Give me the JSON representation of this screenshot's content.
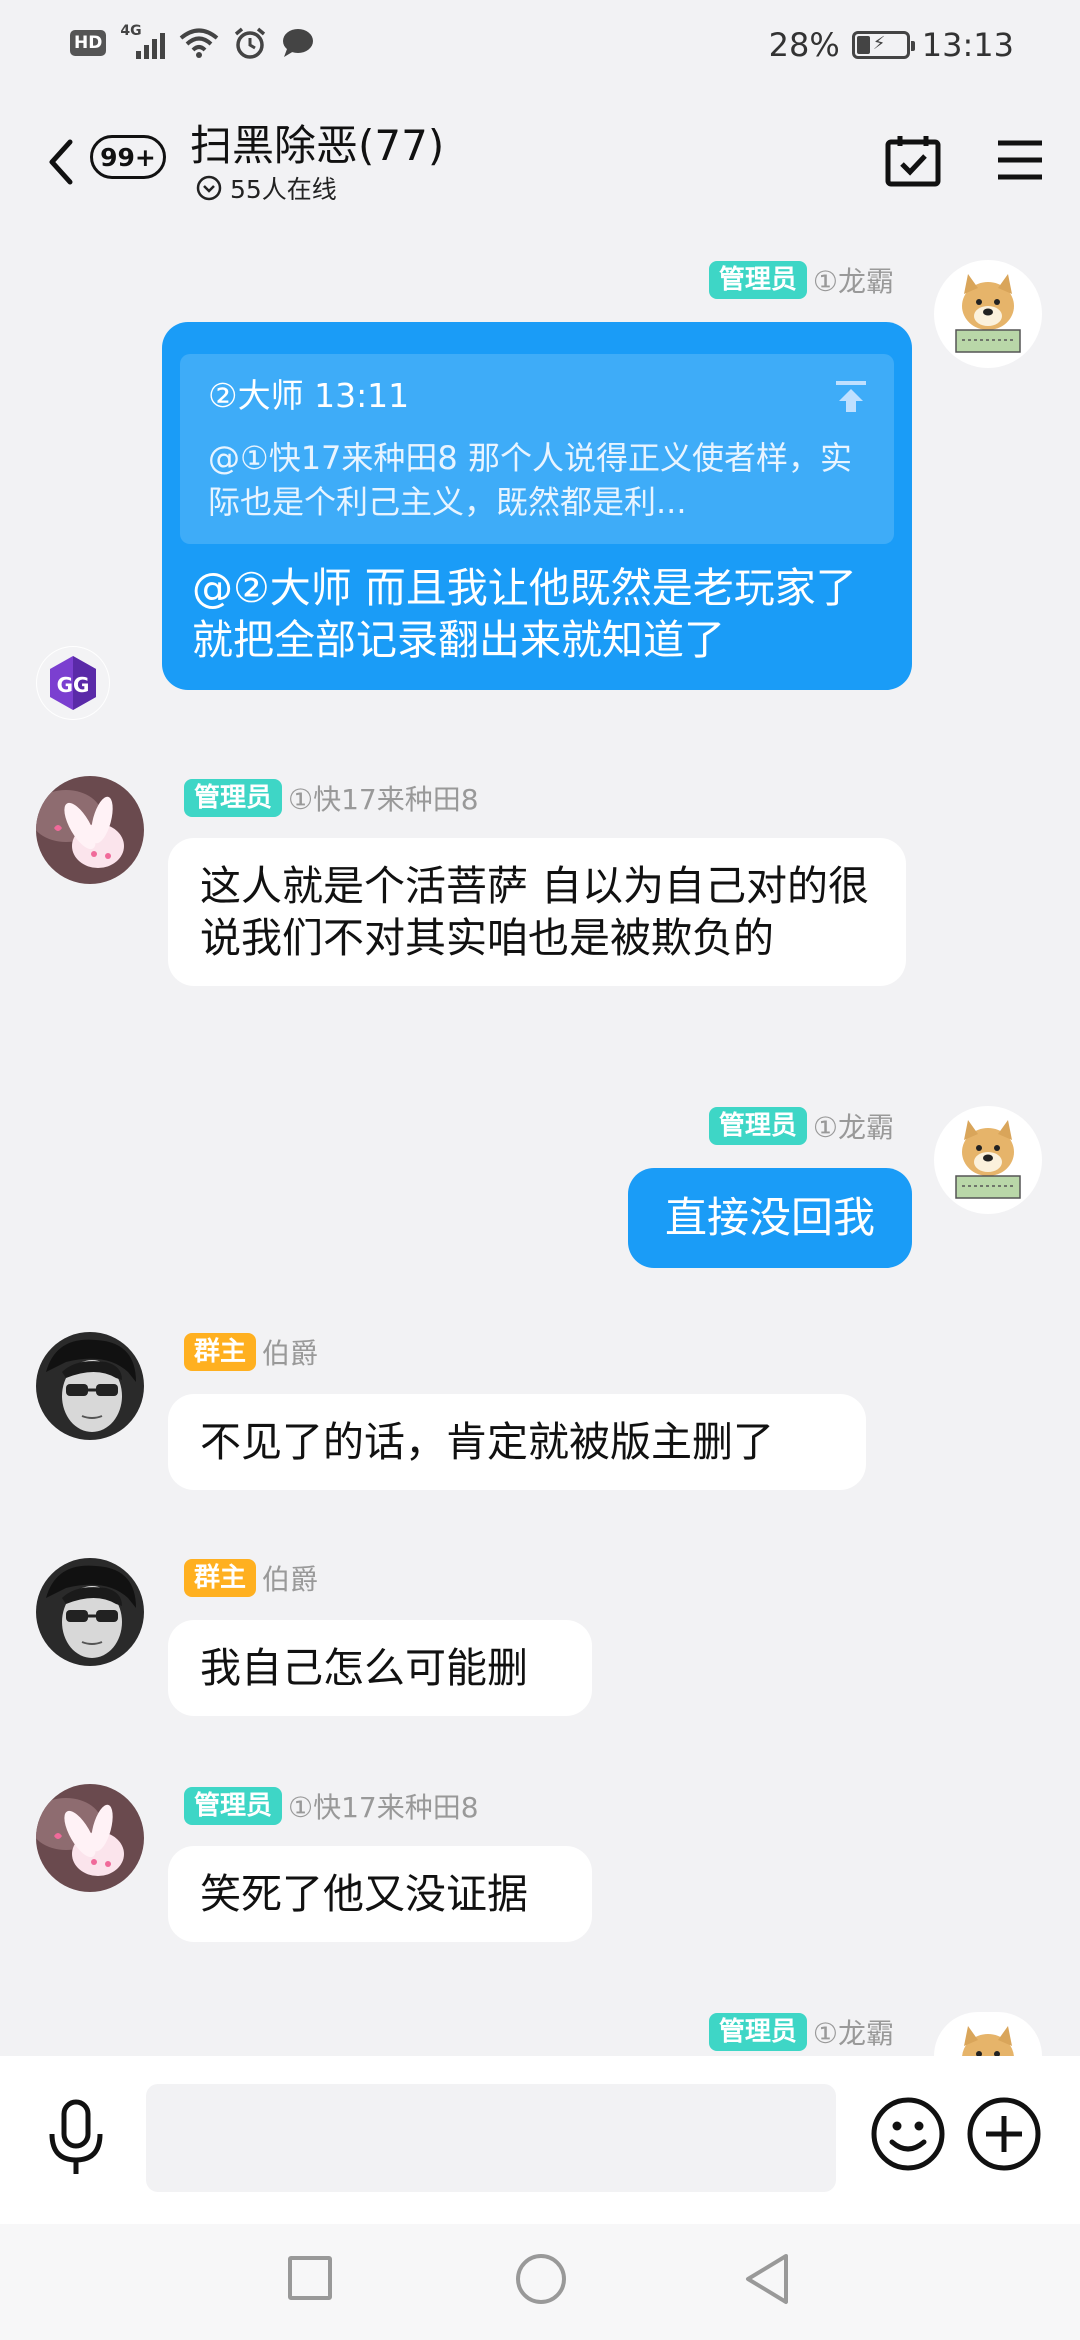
{
  "status_bar": {
    "hd": "HD",
    "network": "4G",
    "battery_percent": "28%",
    "battery_level": 0.28,
    "time": "13:13"
  },
  "header": {
    "unread_count": "99+",
    "title": "扫黑除恶(77)",
    "online": "55人在线"
  },
  "messages": [
    {
      "direction": "out",
      "role": "管理员",
      "sender": "①龙霸",
      "quote": {
        "header": "②大师 13:11",
        "text": "@①快17来种田8 那个人说得正义使者样，实际也是个利己主义，既然都是利..."
      },
      "text": "@②大师 而且我让他既然是老玩家了就把全部记录翻出来就知道了"
    },
    {
      "direction": "in",
      "role": "管理员",
      "sender": "①快17来种田8",
      "text": "这人就是个活菩萨 自以为自己对的很 说我们不对其实咱也是被欺负的"
    },
    {
      "direction": "out",
      "role": "管理员",
      "sender": "①龙霸",
      "text": "直接没回我"
    },
    {
      "direction": "in",
      "role": "群主",
      "sender": "伯爵",
      "text": "不见了的话，肯定就被版主删了"
    },
    {
      "direction": "in",
      "role": "群主",
      "sender": "伯爵",
      "text": "我自己怎么可能删"
    },
    {
      "direction": "in",
      "role": "管理员",
      "sender": "①快17来种田8",
      "text": "笑死了他又没证据"
    },
    {
      "direction": "out",
      "role": "管理员",
      "sender": "①龙霸",
      "text": ""
    }
  ],
  "small_avatar_label": "GG",
  "input": {
    "value": "",
    "placeholder": ""
  },
  "colors": {
    "out_bubble": "#1a9cf7",
    "admin_badge": "#3ed6c6",
    "owner_badge": "#ffb020",
    "background": "#f2f2f4"
  },
  "icons": [
    "signal-icon",
    "wifi-icon",
    "alarm-icon",
    "chat-icon",
    "battery-icon",
    "back-icon",
    "chevron-down-icon",
    "calendar-check-icon",
    "menu-icon",
    "jump-to-quote-icon",
    "microphone-icon",
    "emoji-icon",
    "plus-icon"
  ]
}
